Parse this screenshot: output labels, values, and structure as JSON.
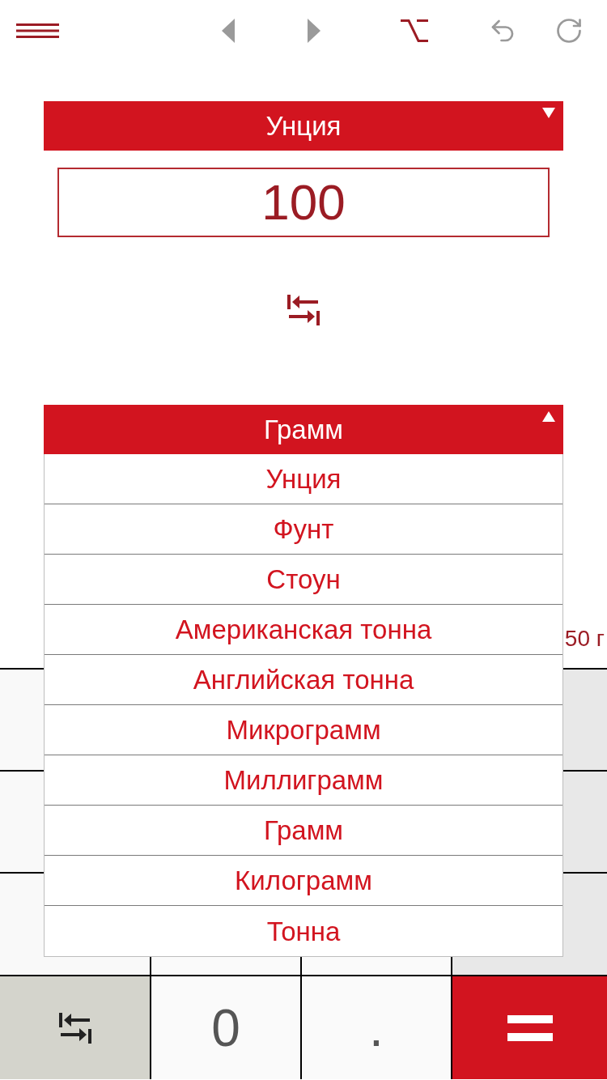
{
  "toolbar": [
    {
      "kind": "menu",
      "disabled": false
    },
    {
      "kind": "back",
      "disabled": true
    },
    {
      "kind": "forward",
      "disabled": true
    },
    {
      "kind": "option",
      "disabled": false
    },
    {
      "kind": "undo",
      "disabled": true
    },
    {
      "kind": "redo",
      "disabled": true
    }
  ],
  "from_unit": {
    "label": "Унция",
    "expanded": false
  },
  "input": {
    "value": "100"
  },
  "to_unit": {
    "label": "Грамм",
    "expanded": true,
    "options": [
      "Унция",
      "Фунт",
      "Стоун",
      "Американская тонна",
      "Английская тонна",
      "Микрограмм",
      "Миллиграмм",
      "Грамм",
      "Килограмм",
      "Тонна"
    ]
  },
  "result": {
    "text": "50 г"
  },
  "keypad": {
    "keys": [
      {
        "kind": "swap"
      },
      {
        "kind": "digit",
        "label": "0"
      },
      {
        "kind": "digit",
        "label": "."
      },
      {
        "kind": "equals"
      }
    ]
  }
}
